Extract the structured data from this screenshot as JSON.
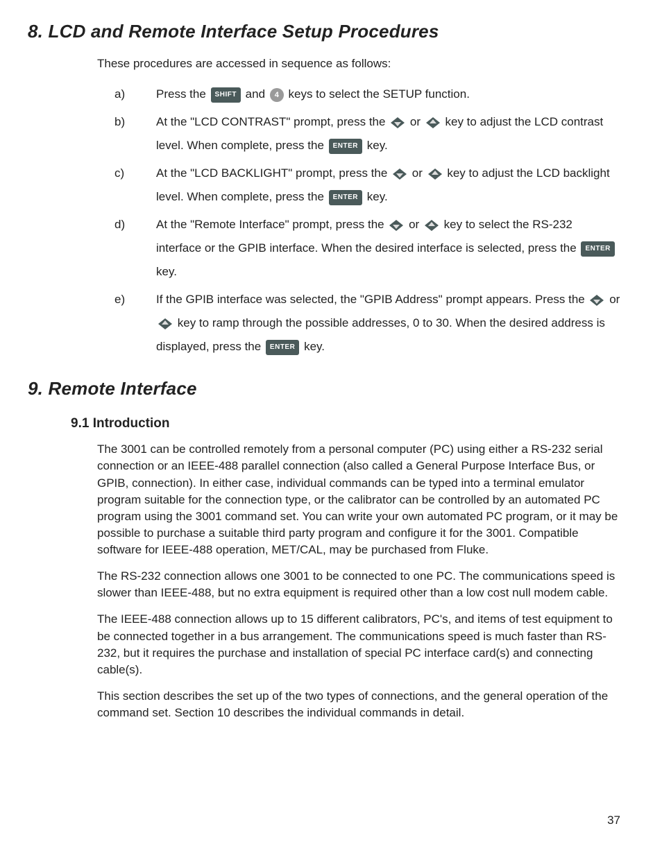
{
  "page_number": "37",
  "section8": {
    "title": "8. LCD and Remote Interface Setup Procedures",
    "intro": "These procedures are accessed in sequence as follows:",
    "steps": {
      "a": {
        "marker": "a)",
        "t1": "Press the ",
        "shift_label": "SHIFT",
        "t2": " and ",
        "four_label": "4",
        "t3": " keys to select the SETUP function."
      },
      "b": {
        "marker": "b)",
        "t1": "At the \"LCD CONTRAST\" prompt, press the ",
        "t2": " or ",
        "t3": " key to adjust the LCD contrast level.  When complete, press the ",
        "enter_label": "ENTER",
        "t4": " key."
      },
      "c": {
        "marker": "c)",
        "t1": "At the \"LCD BACKLIGHT\" prompt, press the ",
        "t2": " or ",
        "t3": " key to adjust the LCD backlight level.  When complete, press the ",
        "enter_label": "ENTER",
        "t4": " key."
      },
      "d": {
        "marker": "d)",
        "t1": "At the \"Remote Interface\" prompt, press the ",
        "t2": " or ",
        "t3": "key to select the RS-232 interface or the GPIB interface.  When the desired interface is selected, press the ",
        "enter_label": "ENTER",
        "t4": " key."
      },
      "e": {
        "marker": "e)",
        "t1": "If the GPIB interface was selected, the \"GPIB Address\" prompt appears.  Press the ",
        "t2": " or ",
        "t3": " key to ramp through the possible addresses, 0 to 30.  When the desired address is displayed, press the ",
        "enter_label": "ENTER",
        "t4": " key."
      }
    }
  },
  "section9": {
    "title": "9. Remote Interface",
    "sub_title": "9.1 Introduction",
    "p1": "The 3001 can be controlled remotely from a personal computer (PC) using either a RS-232 serial connection or an IEEE-488 parallel connection (also called a General Purpose Interface Bus, or GPIB, connection).  In either case, individual commands can be typed into a terminal emulator program suitable for the connection type, or the calibrator can be controlled by an automated PC program using the 3001 command set.  You can write your own automated PC program, or it may be possible to purchase a suitable third party program and configure it for the 3001.  Compatible software for IEEE-488 operation, MET/CAL, may be purchased from Fluke.",
    "p2": "The RS-232 connection allows one 3001 to be connected to one PC.  The communications speed is slower than IEEE-488, but no extra equipment is required other than a low cost null modem cable.",
    "p3": "The IEEE-488 connection allows up to 15 different calibrators, PC's, and items of test equipment to be connected together in a bus arrangement.  The communications speed is much faster than RS-232, but it requires the purchase and installation of special PC interface card(s) and connecting cable(s).",
    "p4": "This section describes the set up of the two types of connections, and the general operation of the command set.  Section 10 describes the individual commands in detail."
  }
}
